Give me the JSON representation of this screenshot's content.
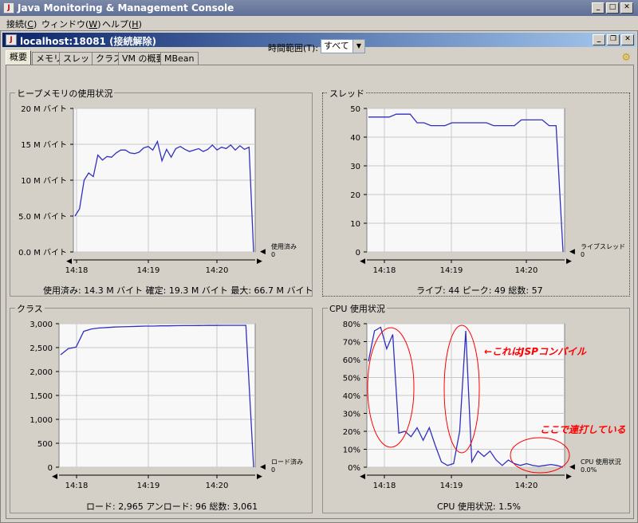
{
  "window": {
    "title": "Java Monitoring & Management Console",
    "icon": "java-icon"
  },
  "menubar": {
    "items": [
      {
        "label": "接続(",
        "mnemonic": "C",
        "suffix": ")"
      },
      {
        "label": "ウィンドウ(",
        "mnemonic": "W",
        "suffix": ")"
      },
      {
        "label": "ヘルプ(",
        "mnemonic": "H",
        "suffix": ")"
      }
    ]
  },
  "connection": {
    "title": "localhost:18081 (接続解除)"
  },
  "tabs": [
    "概要",
    "メモリ",
    "スレッド",
    "クラス",
    "VM の概要",
    "MBean"
  ],
  "time_range": {
    "label": "時間範囲(T):",
    "value": "すべて"
  },
  "panels": {
    "heap": {
      "title": "ヒープメモリの使用状況",
      "legend_label": "使用済み",
      "legend_value": "0",
      "summary": "使用済み: 14.3 M バイト    確定: 19.3 M バイト    最大: 66.7 M バイト"
    },
    "threads": {
      "title": "スレッド",
      "legend_label": "ライブスレッド",
      "legend_value": "0",
      "summary": "ライブ: 44    ピーク: 49    総数: 57"
    },
    "classes": {
      "title": "クラス",
      "legend_label": "ロード済み",
      "legend_value": "0",
      "summary": "ロード: 2,965    アンロード: 96    総数: 3,061"
    },
    "cpu": {
      "title": "CPU 使用状況",
      "legend_label": "CPU 使用状況",
      "legend_value": "0.0%",
      "summary": "CPU 使用状況: 1.5%"
    }
  },
  "annotations": {
    "jsp": "←これはJSPコンパイル",
    "repeat": "ここで連打している"
  },
  "colors": {
    "line": "#3030c0",
    "annotation": "#ff0000"
  },
  "chart_data": [
    {
      "type": "line",
      "title": "ヒープメモリの使用状況",
      "x_ticks": [
        "14:18",
        "14:19",
        "14:20"
      ],
      "y_ticks": [
        "0.0 M バイト",
        "5.0 M バイト",
        "10 M バイト",
        "15 M バイト",
        "20 M バイト"
      ],
      "ylim": [
        0,
        20
      ],
      "series": [
        {
          "name": "使用済み",
          "values": [
            5.0,
            6.0,
            10.0,
            11.0,
            10.5,
            13.5,
            12.8,
            13.3,
            13.2,
            13.8,
            14.2,
            14.2,
            13.8,
            13.7,
            13.9,
            14.5,
            14.7,
            14.2,
            15.4,
            12.7,
            14.3,
            13.2,
            14.4,
            14.7,
            14.3,
            14.0,
            14.2,
            14.4,
            14.0,
            14.3,
            14.9,
            14.2,
            14.6,
            14.4,
            14.9,
            14.2,
            14.8,
            14.3,
            14.6,
            0.0
          ]
        }
      ]
    },
    {
      "type": "line",
      "title": "スレッド",
      "x_ticks": [
        "14:18",
        "14:19",
        "14:20"
      ],
      "y_ticks": [
        "0",
        "10",
        "20",
        "30",
        "40",
        "50"
      ],
      "ylim": [
        0,
        50
      ],
      "series": [
        {
          "name": "ライブスレッド",
          "values": [
            47,
            47,
            47,
            47,
            48,
            48,
            48,
            45,
            45,
            44,
            44,
            44,
            45,
            45,
            45,
            45,
            45,
            45,
            44,
            44,
            44,
            44,
            46,
            46,
            46,
            46,
            44,
            44,
            0
          ]
        }
      ]
    },
    {
      "type": "line",
      "title": "クラス",
      "x_ticks": [
        "14:18",
        "14:19",
        "14:20"
      ],
      "y_ticks": [
        "0",
        "500",
        "1,000",
        "1,500",
        "2,000",
        "2,500",
        "3,000"
      ],
      "ylim": [
        0,
        3000
      ],
      "series": [
        {
          "name": "ロード済み",
          "values": [
            2350,
            2480,
            2510,
            2840,
            2890,
            2910,
            2920,
            2930,
            2935,
            2940,
            2945,
            2950,
            2950,
            2955,
            2955,
            2958,
            2960,
            2960,
            2962,
            2963,
            2964,
            2965,
            2965,
            2965,
            2965,
            0
          ]
        }
      ]
    },
    {
      "type": "line",
      "title": "CPU 使用状況",
      "x_ticks": [
        "14:18",
        "14:19",
        "14:20"
      ],
      "y_ticks": [
        "0%",
        "10%",
        "20%",
        "30%",
        "40%",
        "50%",
        "60%",
        "70%",
        "80%"
      ],
      "ylim": [
        0,
        80
      ],
      "series": [
        {
          "name": "CPU 使用状況",
          "values": [
            59,
            76,
            78,
            66,
            74,
            19,
            20,
            17,
            22,
            15,
            22,
            12,
            3,
            1,
            2,
            20,
            76,
            3,
            9,
            6,
            9,
            4,
            1,
            4,
            2,
            1,
            2,
            1,
            0.5,
            1,
            1.5,
            1,
            0
          ]
        }
      ]
    }
  ]
}
